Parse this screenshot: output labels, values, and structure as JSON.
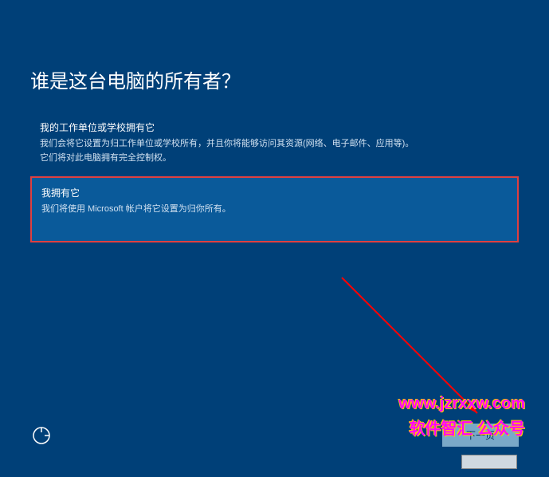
{
  "title": "谁是这台电脑的所有者？",
  "options": {
    "work": {
      "title": "我的工作单位或学校拥有它",
      "desc_line1": "我们会将它设置为归工作单位或学校所有，并且你将能够访问其资源(网络、电子邮件、应用等)。",
      "desc_line2": "它们将对此电脑拥有完全控制权。"
    },
    "personal": {
      "title": "我拥有它",
      "desc": "我们将使用 Microsoft 帐户将它设置为归你所有。"
    }
  },
  "buttons": {
    "next": "下一页"
  },
  "watermark": {
    "url": "www.jzrxxw.com",
    "text": "软件智汇 公众号"
  }
}
